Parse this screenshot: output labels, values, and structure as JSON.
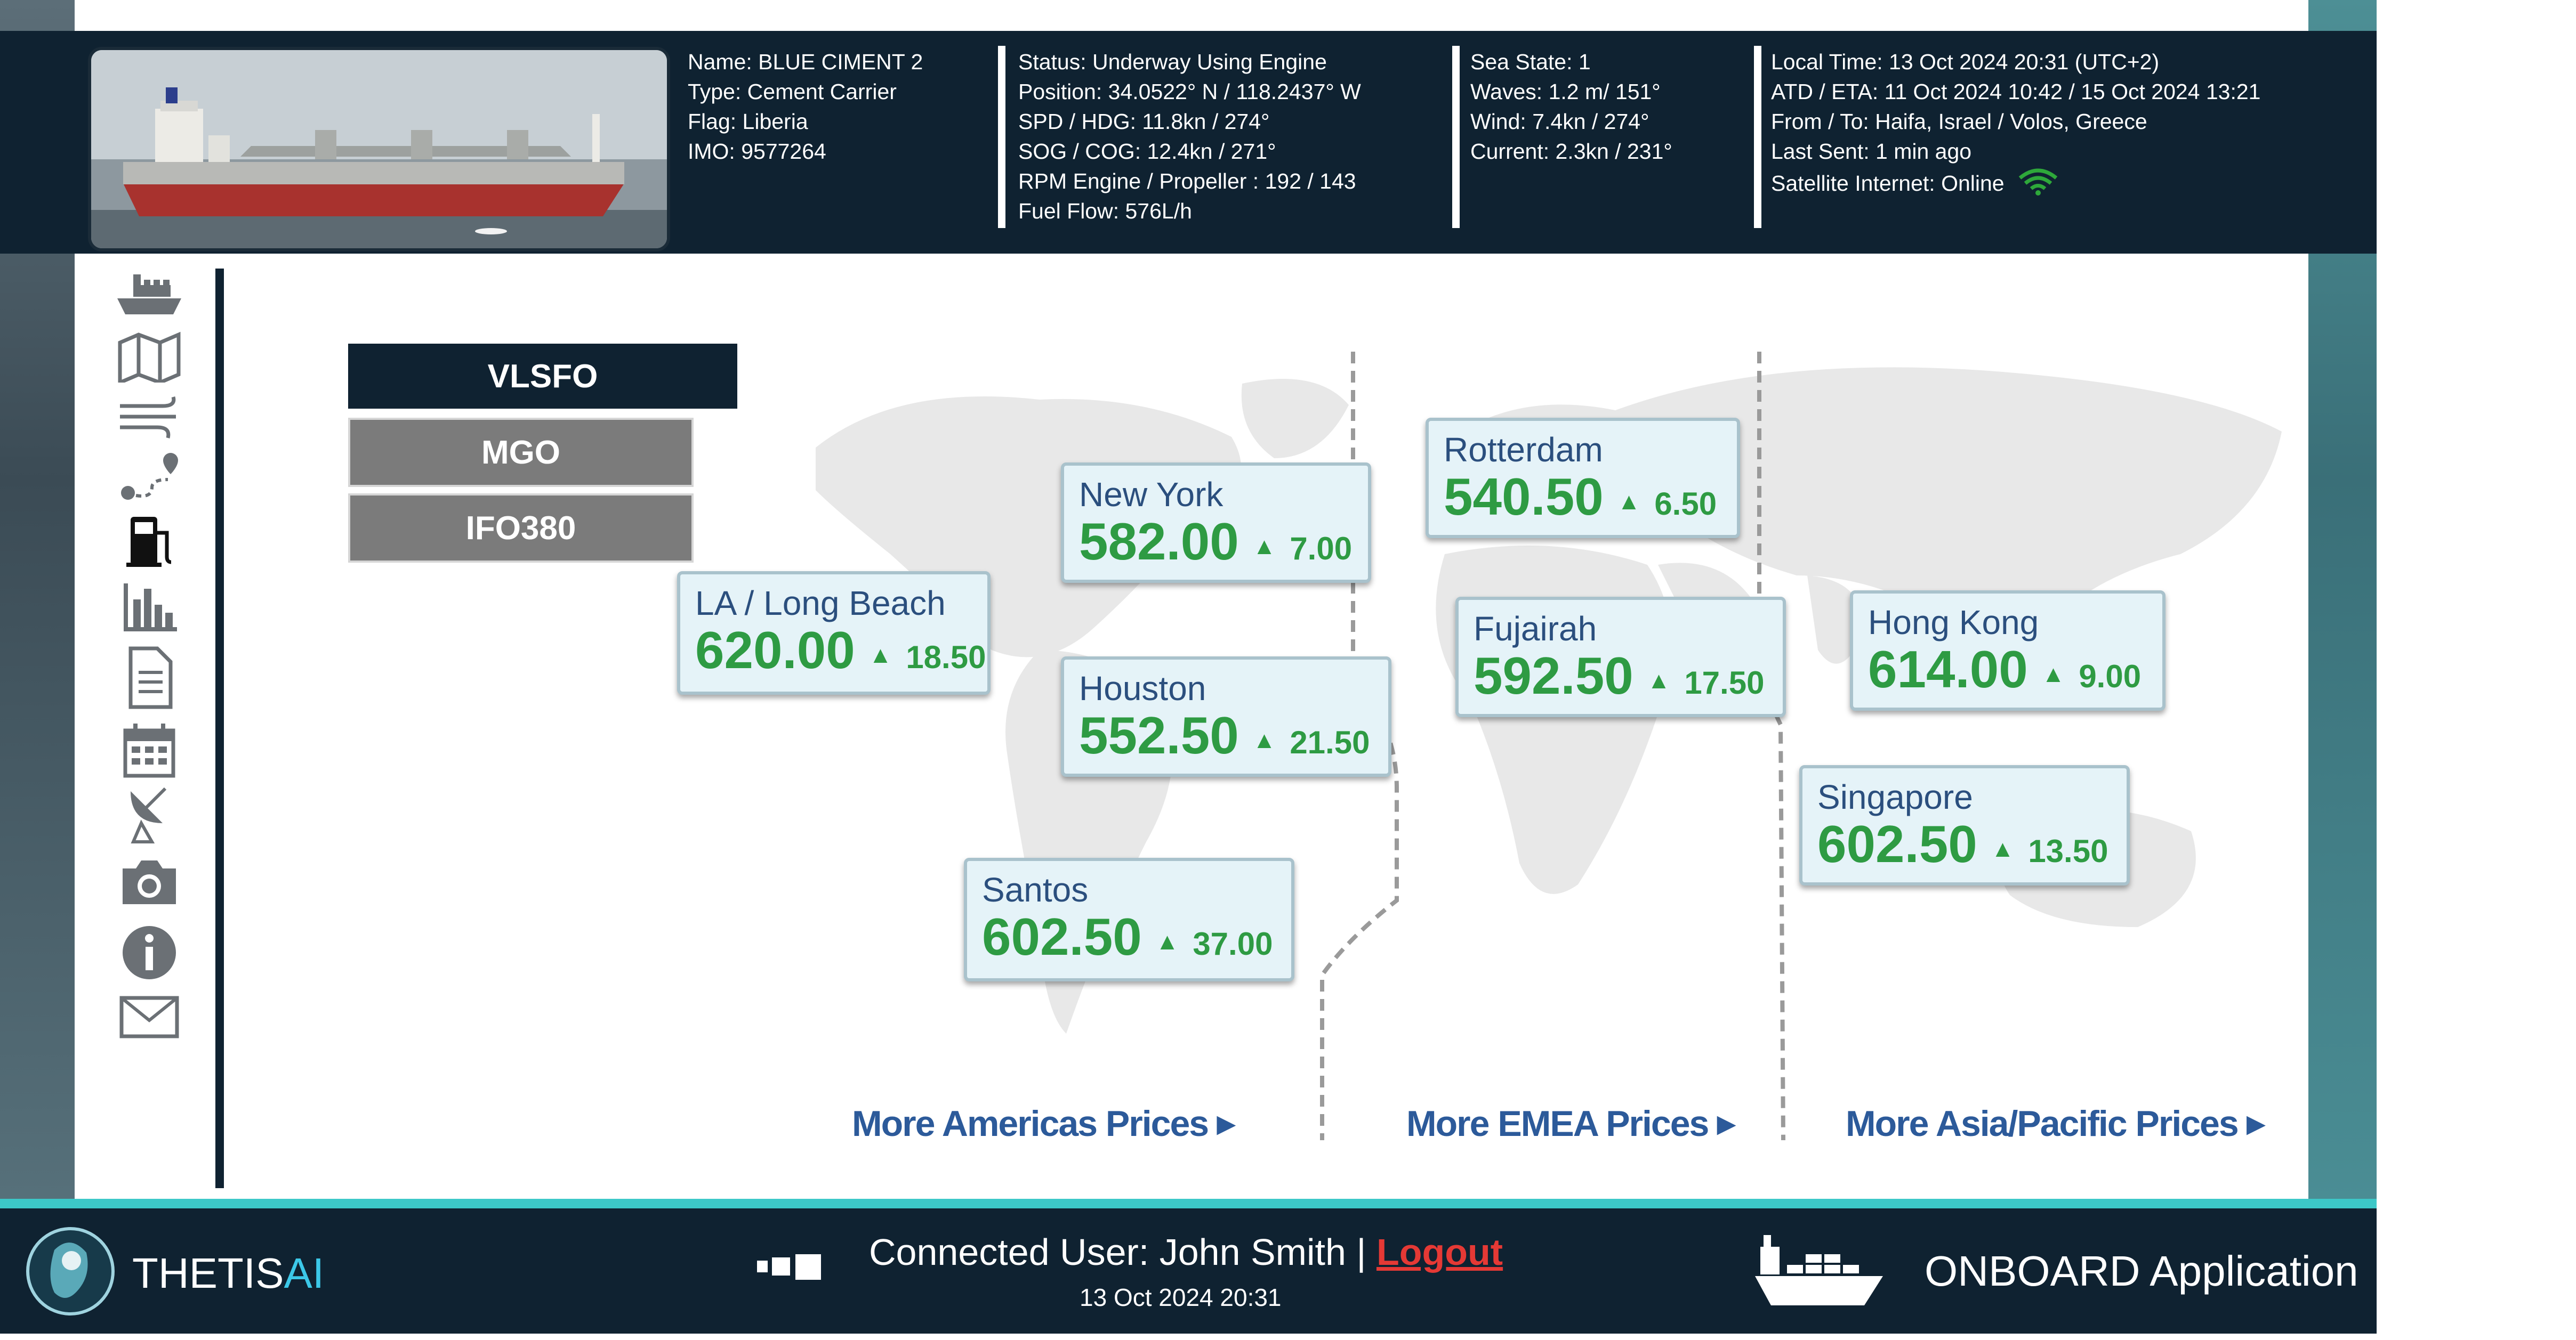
{
  "vessel": {
    "name": "Name: BLUE CIMENT 2",
    "type": "Type: Cement Carrier",
    "flag": "Flag: Liberia",
    "imo": "IMO: 9577264"
  },
  "navigation": {
    "status": "Status: Underway Using Engine",
    "position": "Position: 34.0522° N / 118.2437° W",
    "spd_hdg": "SPD / HDG: 11.8kn / 274°",
    "sog_cog": "SOG / COG: 12.4kn / 271°",
    "rpm": "RPM Engine / Propeller : 192 / 143",
    "fuel_flow": "Fuel Flow: 576L/h"
  },
  "weather": {
    "sea_state": "Sea State: 1",
    "waves": "Waves: 1.2 m/ 151°",
    "wind": "Wind: 7.4kn / 274°",
    "current": "Current: 2.3kn / 231°"
  },
  "voyage": {
    "local_time": "Local Time: 13 Oct 2024 20:31 (UTC+2)",
    "atd_eta": "ATD / ETA: 11 Oct 2024 10:42  / 15 Oct 2024 13:21",
    "from_to": "From / To: Haifa, Israel / Volos, Greece",
    "last_sent": "Last Sent: 1 min ago",
    "internet": "Satellite Internet: Online",
    "internet_status_color": "#3cc83c"
  },
  "sidebar_icons": [
    "ship-icon",
    "map-icon",
    "wind-icon",
    "route-icon",
    "fuel-pump-icon",
    "bar-chart-icon",
    "document-icon",
    "calendar-icon",
    "satellite-dish-icon",
    "camera-icon",
    "info-icon",
    "mail-icon"
  ],
  "fuel_tabs": [
    {
      "label": "VLSFO",
      "active": true
    },
    {
      "label": "MGO",
      "active": false
    },
    {
      "label": "IFO380",
      "active": false
    }
  ],
  "ports": [
    {
      "city": "LA / Long Beach",
      "price": "620.00",
      "change": "18.50"
    },
    {
      "city": "New York",
      "price": "582.00",
      "change": "7.00"
    },
    {
      "city": "Houston",
      "price": "552.50",
      "change": "21.50"
    },
    {
      "city": "Santos",
      "price": "602.50",
      "change": "37.00"
    },
    {
      "city": "Rotterdam",
      "price": "540.50",
      "change": "6.50"
    },
    {
      "city": "Fujairah",
      "price": "592.50",
      "change": "17.50"
    },
    {
      "city": "Hong Kong",
      "price": "614.00",
      "change": "9.00"
    },
    {
      "city": "Singapore",
      "price": "602.50",
      "change": "13.50"
    }
  ],
  "more_links": {
    "americas": "More Americas Prices",
    "emea": "More EMEA Prices",
    "apac": "More Asia/Pacific Prices"
  },
  "footer": {
    "brand_main": "THETIS",
    "brand_ai": "AI",
    "connected_prefix": "Connected User: John Smith | ",
    "logout": "Logout",
    "date": "13 Oct 2024 20:31",
    "app_name": "ONBOARD Application"
  },
  "colors": {
    "header_bg": "#0f2231",
    "accent": "#3cc8c8",
    "price_green": "#2e9b43",
    "city_blue": "#2b4f7e",
    "logout_red": "#e53935"
  }
}
